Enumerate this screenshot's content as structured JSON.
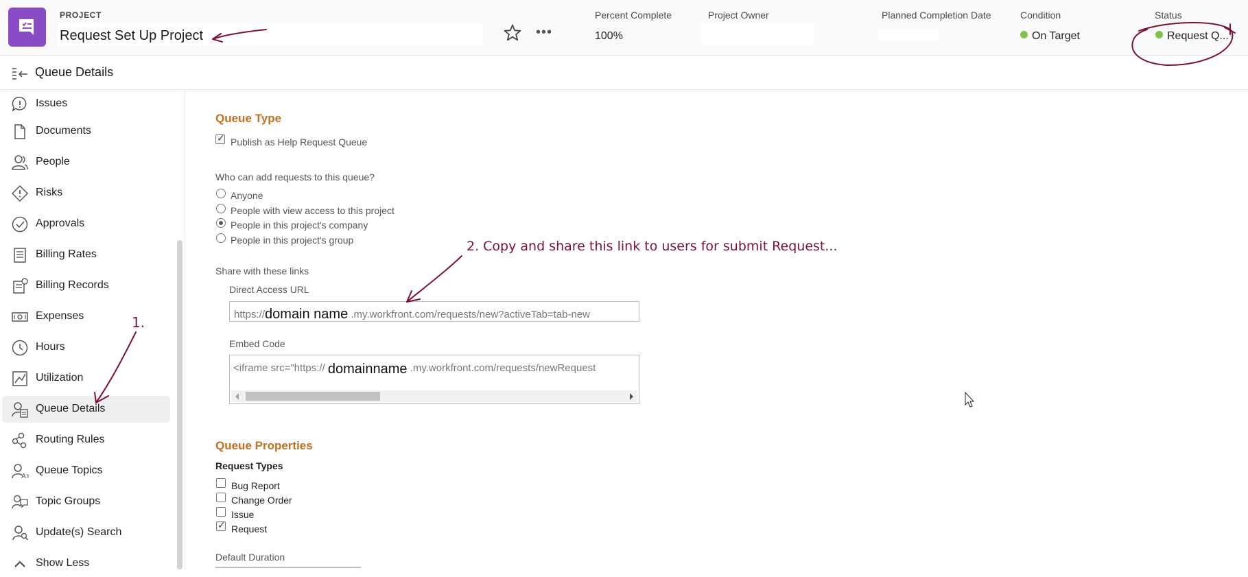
{
  "header": {
    "project_label": "PROJECT",
    "project_title": "Request Set Up Project",
    "percent_complete_label": "Percent Complete",
    "percent_complete_value": "100%",
    "project_owner_label": "Project Owner",
    "planned_completion_label": "Planned Completion Date",
    "condition_label": "Condition",
    "condition_value": "On Target",
    "status_label": "Status",
    "status_value": "Request Q...",
    "more_icon": "•••"
  },
  "breadcrumb": {
    "title": "Queue Details"
  },
  "sidebar": {
    "items": [
      {
        "label": "Issues",
        "icon": "issues-icon"
      },
      {
        "label": "Documents",
        "icon": "document-icon"
      },
      {
        "label": "People",
        "icon": "people-icon"
      },
      {
        "label": "Risks",
        "icon": "risk-icon"
      },
      {
        "label": "Approvals",
        "icon": "approvals-icon"
      },
      {
        "label": "Billing Rates",
        "icon": "billing-rates-icon"
      },
      {
        "label": "Billing Records",
        "icon": "billing-records-icon"
      },
      {
        "label": "Expenses",
        "icon": "expenses-icon"
      },
      {
        "label": "Hours",
        "icon": "clock-icon"
      },
      {
        "label": "Utilization",
        "icon": "chart-icon"
      },
      {
        "label": "Queue Details",
        "icon": "queue-details-icon",
        "active": true
      },
      {
        "label": "Routing Rules",
        "icon": "routing-icon"
      },
      {
        "label": "Queue Topics",
        "icon": "queue-topics-icon"
      },
      {
        "label": "Topic Groups",
        "icon": "topic-groups-icon"
      },
      {
        "label": "Update(s) Search",
        "icon": "search-icon"
      },
      {
        "label": "Show Less",
        "icon": "chevron-up-icon"
      }
    ]
  },
  "main": {
    "queue_type": {
      "title": "Queue Type",
      "publish_label": "Publish as Help Request Queue",
      "publish_checked": true,
      "who_question": "Who can add requests to this queue?",
      "options": [
        {
          "label": "Anyone",
          "selected": false
        },
        {
          "label": "People with view access to this project",
          "selected": false
        },
        {
          "label": "People in this project's company",
          "selected": true
        },
        {
          "label": "People in this project's group",
          "selected": false
        }
      ],
      "share_label": "Share with these links",
      "direct_url_label": "Direct Access URL",
      "direct_url_prefix": "https://",
      "direct_url_domain": "domain name",
      "direct_url_suffix": ".my.workfront.com/requests/new?activeTab=tab-new",
      "embed_label": "Embed Code",
      "embed_prefix": "<iframe src=\"https://",
      "embed_domain": "domainname",
      "embed_suffix": ".my.workfront.com/requests/newRequest"
    },
    "queue_properties": {
      "title": "Queue Properties",
      "request_types_label": "Request Types",
      "request_types": [
        {
          "label": "Bug Report",
          "checked": false
        },
        {
          "label": "Change Order",
          "checked": false
        },
        {
          "label": "Issue",
          "checked": false
        },
        {
          "label": "Request",
          "checked": true
        }
      ],
      "default_duration_label": "Default Duration"
    }
  },
  "annotations": {
    "step1": "1.",
    "step2": "2. Copy and share this link to users for submit Request...",
    "color": "#7a1230"
  }
}
